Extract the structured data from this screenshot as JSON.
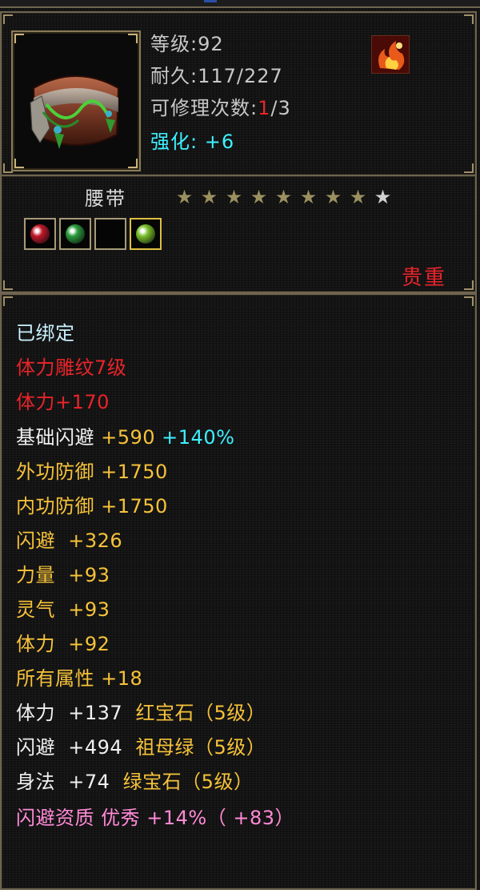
{
  "item": {
    "level_label": "等级:",
    "level_value": "92",
    "durability_label": "耐久:",
    "durability_value": "117/227",
    "repair_label": "可修理次数:",
    "repair_used": "1",
    "repair_total": "/3",
    "enhance_label": "强化:",
    "enhance_value": "+6",
    "name": "腰带",
    "stars_filled": 8,
    "stars_total": 9,
    "quality": "贵重"
  },
  "gem_slots": [
    {
      "name": "gem-slot-red",
      "color": "#c0182a",
      "filled": true,
      "active": false
    },
    {
      "name": "gem-slot-emerald",
      "color": "#2a9a3a",
      "filled": true,
      "active": false
    },
    {
      "name": "gem-slot-empty",
      "color": "",
      "filled": false,
      "active": false
    },
    {
      "name": "gem-slot-green",
      "color": "#7ac02a",
      "filled": true,
      "active": true
    }
  ],
  "attributes": {
    "bound": "已绑定",
    "engrave": "体力雕纹7级",
    "engrave_bonus": "体力+170",
    "base_dodge_label": "基础闪避",
    "base_dodge_value": " +590",
    "base_dodge_pct": " +140%",
    "ext_def_label": "外功防御",
    "ext_def_value": " +1750",
    "int_def_label": "内功防御",
    "int_def_value": " +1750",
    "dodge_label": "闪避",
    "dodge_value": "  +326",
    "str_label": "力量",
    "str_value": "  +93",
    "spirit_label": "灵气",
    "spirit_value": "  +93",
    "vit_label": "体力",
    "vit_value": "  +92",
    "all_label": "所有属性",
    "all_value": " +18",
    "gem1_stat": "体力  +137",
    "gem1_name": "  红宝石",
    "gem1_level": "（5级）",
    "gem2_stat": "闪避  +494",
    "gem2_name": "  祖母绿",
    "gem2_level": "（5级）",
    "gem3_stat": "身法  +74",
    "gem3_name": "  绿宝石",
    "gem3_level": "（5级）",
    "aptitude": "闪避资质   优秀  +14%（ +83）"
  },
  "colors": {
    "border": "#6e6450",
    "red": "#e8242a",
    "cyan": "#3ff0ff",
    "orange": "#f7c23a",
    "pink": "#ff8ad6"
  }
}
